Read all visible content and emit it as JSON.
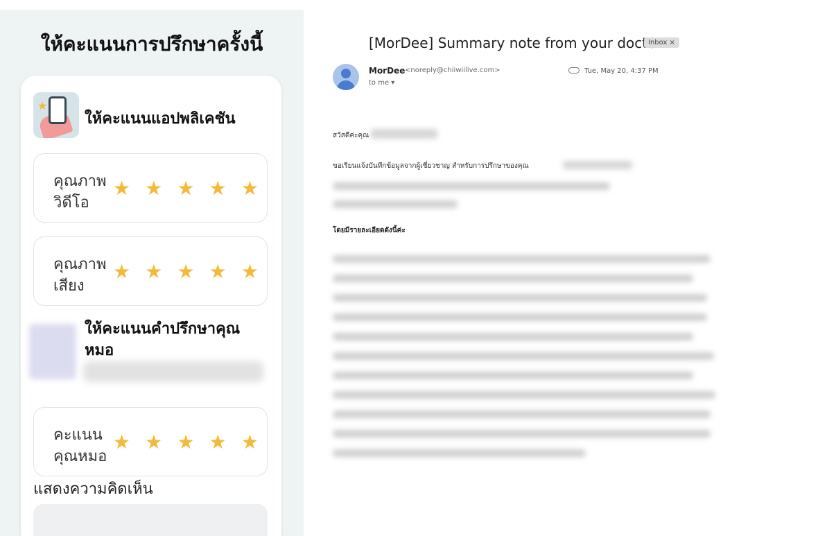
{
  "rating": {
    "title": "ให้คะแนนการปรึกษาครั้งนี้",
    "app_heading": "ให้คะแนนแอปพลิเคชัน",
    "video_quality_label": "คุณภาพวิดีโอ",
    "audio_quality_label": "คุณภาพเสียง",
    "doctor_heading": "ให้คะแนนคำปรึกษาคุณหมอ",
    "doctor_score_label": "คะแนนคุณหมอ",
    "comment_label": "แสดงความคิดเห็น",
    "star_glyph": "★",
    "star_color": "#f5b93a",
    "video_stars": 5,
    "audio_stars": 5,
    "doctor_stars": 5
  },
  "email": {
    "subject": "[MorDee] Summary note from your doctor.",
    "label_badge": "Inbox ×",
    "sender_name": "MorDee",
    "sender_email": "<noreply@chiiwiilive.com>",
    "to": "to me ▾",
    "date": "Tue, May 20, 4:37 PM",
    "greeting": "สวัสดีค่ะคุณ",
    "intro": "ขอเรียนแจ้งบันทึกข้อมูลจากผู้เชี่ยวชาญ สำหรับการปรึกษาของคุณ",
    "details_heading": "โดยมีรายละเอียดดังนี้ค่ะ"
  }
}
